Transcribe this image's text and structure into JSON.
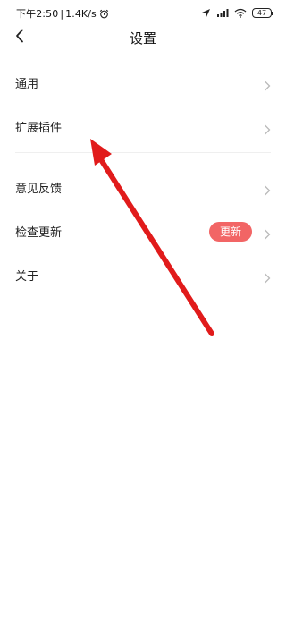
{
  "status_bar": {
    "time": "下午2:50",
    "separator": "|",
    "network_speed": "1.4K/s",
    "battery_level": "47"
  },
  "nav": {
    "title": "设置"
  },
  "settings": {
    "items": [
      {
        "label": "通用"
      },
      {
        "label": "扩展插件"
      },
      {
        "label": "意见反馈"
      },
      {
        "label": "检查更新",
        "badge": "更新"
      },
      {
        "label": "关于"
      }
    ]
  },
  "colors": {
    "badge": "#f26565",
    "annotation_arrow": "#e11b1b",
    "chevron": "#b9b9b9"
  },
  "icons": {
    "back": "chevron-left-icon",
    "row_arrow": "chevron-right-icon",
    "alarm": "alarm-clock-icon",
    "location": "location-arrow-icon",
    "signal": "cellular-signal-icon",
    "wifi": "wifi-icon",
    "battery": "battery-icon"
  }
}
